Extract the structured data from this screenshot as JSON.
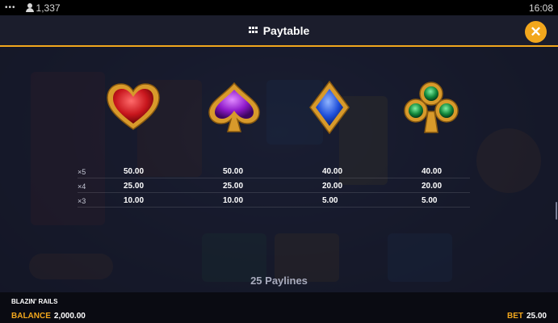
{
  "status_bar": {
    "menu": "•••",
    "players": "1,337",
    "time": "16:08"
  },
  "header": {
    "title": "Paytable",
    "close": "✕"
  },
  "symbols": [
    {
      "name": "heart",
      "color": "#c8161d"
    },
    {
      "name": "spade",
      "color": "#8e19c9"
    },
    {
      "name": "diamond",
      "color": "#1f4fd9"
    },
    {
      "name": "club",
      "color": "#138a3c"
    }
  ],
  "paytable": {
    "rows": [
      {
        "multiplier": "×5",
        "values": [
          "50.00",
          "50.00",
          "40.00",
          "40.00"
        ]
      },
      {
        "multiplier": "×4",
        "values": [
          "25.00",
          "25.00",
          "20.00",
          "20.00"
        ]
      },
      {
        "multiplier": "×3",
        "values": [
          "10.00",
          "10.00",
          "5.00",
          "5.00"
        ]
      }
    ]
  },
  "paylines": "25 Paylines",
  "footer": {
    "game_name": "BLAZIN' RAILS",
    "balance_label": "BALANCE",
    "balance_value": "2,000.00",
    "bet_label": "BET",
    "bet_value": "25.00"
  },
  "colors": {
    "accent": "#f2a71d",
    "header_bg": "#1b1d2c"
  }
}
